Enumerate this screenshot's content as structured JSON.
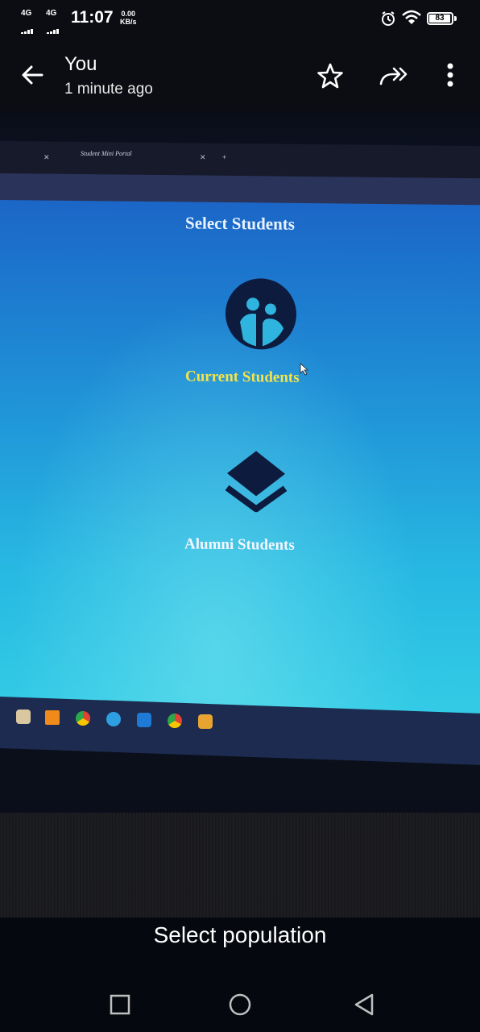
{
  "status_bar": {
    "network_1": "4G",
    "network_2": "4G",
    "time": "11:07",
    "speed_value": "0.00",
    "speed_unit": "KB/s",
    "battery_level": "83",
    "icons": [
      "alarm-icon",
      "wifi-icon",
      "battery-icon"
    ]
  },
  "header": {
    "sender": "You",
    "time_ago": "1 minute ago",
    "actions": [
      "star-icon",
      "forward-icon",
      "more-vertical-icon"
    ]
  },
  "photo": {
    "browser_tab_title": "Student Mini Portal",
    "screen_title": "Select Students",
    "current_label": "Current Students",
    "alumni_label": "Alumni Students",
    "colors": {
      "screen_top": "#1b66c7",
      "screen_bottom": "#34cde6",
      "current_label": "#f3e44a",
      "icon_fill": "#0d1b3e"
    }
  },
  "caption": "Select population",
  "nav": [
    "square-recents-icon",
    "circle-home-icon",
    "triangle-back-icon"
  ]
}
